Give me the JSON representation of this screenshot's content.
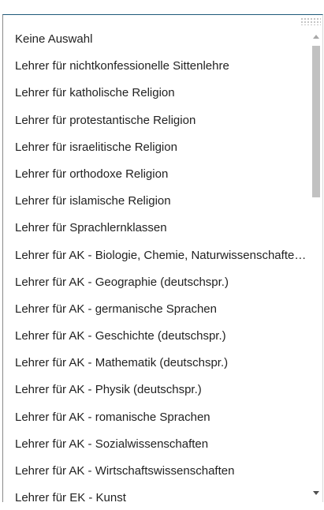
{
  "options": [
    {
      "label": "Keine Auswahl"
    },
    {
      "label": "Lehrer für nichtkonfessionelle Sittenlehre"
    },
    {
      "label": "Lehrer für katholische Religion"
    },
    {
      "label": "Lehrer für protestantische Religion"
    },
    {
      "label": "Lehrer für israelitische Religion"
    },
    {
      "label": "Lehrer für orthodoxe Religion"
    },
    {
      "label": "Lehrer für islamische Religion"
    },
    {
      "label": "Lehrer für Sprachlernklassen"
    },
    {
      "label": "Lehrer für AK - Biologie, Chemie, Naturwissenschaften (deutschspr.)"
    },
    {
      "label": "Lehrer für AK - Geographie (deutschspr.)"
    },
    {
      "label": "Lehrer für AK - germanische Sprachen"
    },
    {
      "label": "Lehrer für AK - Geschichte (deutschspr.)"
    },
    {
      "label": "Lehrer für AK - Mathematik (deutschspr.)"
    },
    {
      "label": "Lehrer für AK - Physik (deutschspr.)"
    },
    {
      "label": "Lehrer für AK - romanische Sprachen"
    },
    {
      "label": "Lehrer für AK - Sozialwissenschaften"
    },
    {
      "label": "Lehrer für AK - Wirtschaftswissenschaften"
    },
    {
      "label": "Lehrer für EK - Kunst"
    }
  ],
  "colors": {
    "dropdown_top_border": "#1f5a7a",
    "text": "#222222",
    "scrollbar_thumb": "#c1c1c1"
  },
  "icons": {
    "scroll_up": "scroll-up-arrow-icon",
    "scroll_down": "scroll-down-arrow-icon",
    "resize_grip": "resize-grip-icon"
  }
}
